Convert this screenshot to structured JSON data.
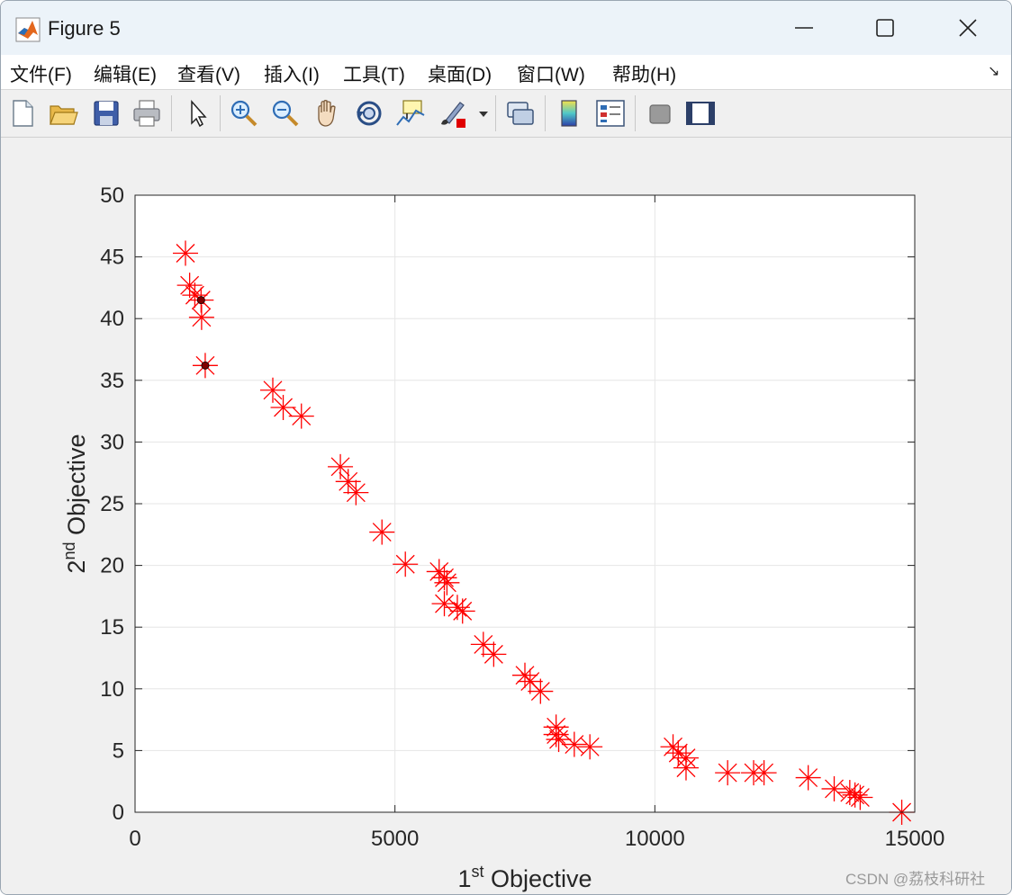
{
  "window": {
    "title": "Figure 5"
  },
  "menu": {
    "items": [
      "文件(F)",
      "编辑(E)",
      "查看(V)",
      "插入(I)",
      "工具(T)",
      "桌面(D)",
      "窗口(W)",
      "帮助(H)"
    ],
    "undock_glyph": "↘"
  },
  "toolbar": {
    "icons": [
      "new-figure-icon",
      "open-file-icon",
      "save-icon",
      "print-icon",
      "select-arrow-icon",
      "zoom-in-icon",
      "zoom-out-icon",
      "pan-hand-icon",
      "rotate-3d-icon",
      "data-cursor-icon",
      "brush-icon",
      "link-plot-icon",
      "colorbar-icon",
      "legend-icon",
      "hide-plot-tools-icon",
      "show-plot-tools-icon"
    ]
  },
  "chart_data": {
    "type": "scatter",
    "xlabel": {
      "prefix": "1",
      "sup": "st",
      "rest": " Objective"
    },
    "ylabel": {
      "prefix": "2",
      "sup": "nd",
      "rest": " Objective"
    },
    "xlim": [
      0,
      15000
    ],
    "ylim": [
      0,
      50
    ],
    "xticks": [
      0,
      5000,
      10000,
      15000
    ],
    "yticks": [
      0,
      5,
      10,
      15,
      20,
      25,
      30,
      35,
      40,
      45,
      50
    ],
    "grid": true,
    "marker": "asterisk",
    "color": "#ff0000",
    "highlight_color": "#800000",
    "points": [
      [
        970,
        45.3
      ],
      [
        1050,
        42.7
      ],
      [
        1150,
        41.9
      ],
      [
        1270,
        41.5
      ],
      [
        1280,
        40.1
      ],
      [
        1350,
        36.2
      ],
      [
        2650,
        34.2
      ],
      [
        2850,
        32.8
      ],
      [
        3200,
        32.1
      ],
      [
        3950,
        28.0
      ],
      [
        4100,
        26.8
      ],
      [
        4250,
        25.9
      ],
      [
        4750,
        22.7
      ],
      [
        5200,
        20.1
      ],
      [
        5850,
        19.5
      ],
      [
        5950,
        19.0
      ],
      [
        6000,
        18.6
      ],
      [
        5950,
        16.9
      ],
      [
        6200,
        16.6
      ],
      [
        6300,
        16.3
      ],
      [
        6700,
        13.6
      ],
      [
        6900,
        12.8
      ],
      [
        7500,
        11.1
      ],
      [
        7600,
        10.6
      ],
      [
        7800,
        9.8
      ],
      [
        8100,
        6.9
      ],
      [
        8100,
        6.3
      ],
      [
        8150,
        5.9
      ],
      [
        8450,
        5.5
      ],
      [
        8750,
        5.3
      ],
      [
        10350,
        5.3
      ],
      [
        10450,
        4.8
      ],
      [
        10600,
        4.4
      ],
      [
        10600,
        3.6
      ],
      [
        11400,
        3.2
      ],
      [
        11900,
        3.2
      ],
      [
        12100,
        3.2
      ],
      [
        12950,
        2.8
      ],
      [
        13450,
        1.9
      ],
      [
        13750,
        1.6
      ],
      [
        13850,
        1.4
      ],
      [
        13950,
        1.2
      ],
      [
        14750,
        0.0
      ]
    ],
    "highlighted": [
      [
        1270,
        41.5
      ],
      [
        1350,
        36.2
      ]
    ]
  },
  "watermark": "CSDN @荔枝科研社"
}
